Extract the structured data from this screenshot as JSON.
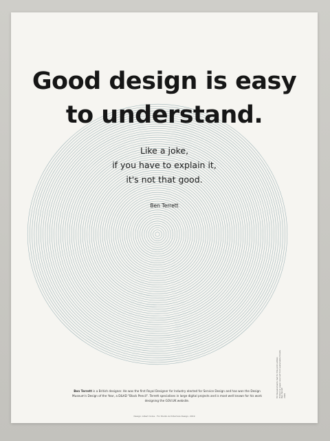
{
  "poster": {
    "headline": [
      "Good design is easy",
      "to understand."
    ],
    "quote": [
      "Like a joke,",
      "if you have to explain it,",
      "it's not that good."
    ],
    "author": "Ben Terrett",
    "bio": {
      "name": "Ben Terrett",
      "text": " is a British designer. He was the first Royal Designer for Industry elected for Service Design and has won the Design Museum's Design of the Year, a D&AD \"Black Pencil\". Terrett specialises in large digital projects and is most well known for his work designing the GOV.UK website."
    },
    "credit": "Design: Albert Irvine · For Studio Architecture Design, 2019",
    "side_note": [
      "Ed: Requirements met for this print edition",
      "Printed on paper sourced from sustainable forests",
      "Ben Terrett",
      "2019"
    ]
  },
  "colors": {
    "paper": "#f6f5f1",
    "rings": "#8aa6ab",
    "ink": "#161616"
  }
}
